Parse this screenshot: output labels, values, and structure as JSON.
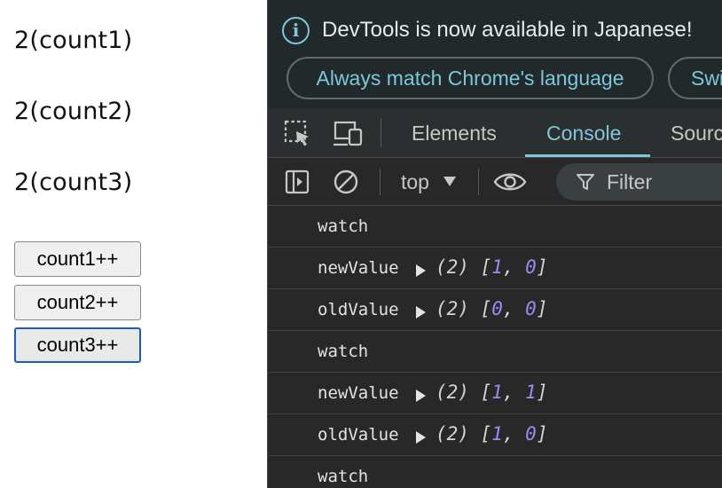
{
  "app": {
    "counters": [
      "2(count1)",
      "2(count2)",
      "2(count3)"
    ],
    "buttons": [
      "count1++",
      "count2++",
      "count3++"
    ]
  },
  "devtools": {
    "info_text": "DevTools is now available in Japanese!",
    "match_language_label": "Always match Chrome's language",
    "switch_label": "Swi",
    "tabs": [
      "Elements",
      "Console",
      "Sourc"
    ],
    "context_label": "top",
    "filter_placeholder": "Filter",
    "accent": "#7cc7d9",
    "number_color": "#9b8cf2",
    "log": [
      {
        "key": "watch"
      },
      {
        "key": "newValue",
        "prefix": "(2) [",
        "a": "1",
        "sep": ", ",
        "b": "0",
        "suffix": "]"
      },
      {
        "key": "oldValue",
        "prefix": "(2) [",
        "a": "0",
        "sep": ", ",
        "b": "0",
        "suffix": "]"
      },
      {
        "key": "watch"
      },
      {
        "key": "newValue",
        "prefix": "(2) [",
        "a": "1",
        "sep": ", ",
        "b": "1",
        "suffix": "]"
      },
      {
        "key": "oldValue",
        "prefix": "(2) [",
        "a": "1",
        "sep": ", ",
        "b": "0",
        "suffix": "]"
      },
      {
        "key": "watch"
      }
    ]
  }
}
